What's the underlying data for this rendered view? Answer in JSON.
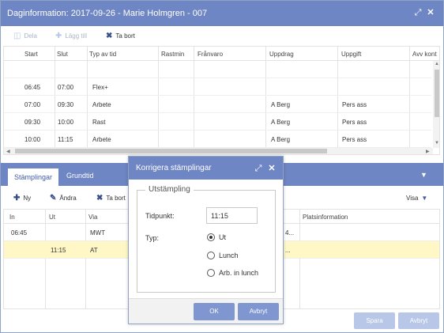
{
  "window": {
    "title": "Daginformation: 2017-09-26 - Marie Holmgren - 007"
  },
  "toolbar": {
    "dela": "Dela",
    "lagg_till": "Lägg till",
    "ta_bort": "Ta bort"
  },
  "grid": {
    "headers": [
      "Start",
      "Slut",
      "Typ av tid",
      "Rastmin",
      "Frånvaro",
      "Uppdrag",
      "Uppgift",
      "Avv kont"
    ],
    "rows": [
      [
        "",
        "",
        "",
        "",
        "",
        "",
        "",
        ""
      ],
      [
        "06:45",
        "07:00",
        "Flex+",
        "",
        "",
        "",
        "",
        ""
      ],
      [
        "07:00",
        "09:30",
        "Arbete",
        "",
        "",
        "A Berg",
        "Pers ass",
        ""
      ],
      [
        "09:30",
        "10:00",
        "Rast",
        "",
        "",
        "A Berg",
        "Pers ass",
        ""
      ],
      [
        "10:00",
        "11:15",
        "Arbete",
        "",
        "",
        "A Berg",
        "Pers ass",
        ""
      ]
    ]
  },
  "tabs": {
    "stamplingar": "Stämplingar",
    "grundtid": "Grundtid"
  },
  "toolbar2": {
    "ny": "Ny",
    "andra": "Ändra",
    "ta_bort": "Ta bort",
    "visa": "Visa"
  },
  "grid2": {
    "headers": [
      "In",
      "Ut",
      "Via",
      "Platsinformation"
    ],
    "rows": [
      [
        "06:45",
        "",
        "MWT",
        "4..."
      ],
      [
        "",
        "11:15",
        "AT",
        "..."
      ]
    ]
  },
  "footer": {
    "spara": "Spara",
    "avbryt": "Avbryt"
  },
  "modal": {
    "title": "Korrigera stämplingar",
    "fieldset_legend": "Utstämpling",
    "tidpunkt_label": "Tidpunkt:",
    "tidpunkt_value": "11:15",
    "typ_label": "Typ:",
    "options": [
      "Ut",
      "Lunch",
      "Arb. in lunch"
    ],
    "selected_option": "Ut",
    "ok": "OK",
    "avbryt": "Avbryt"
  },
  "colors": {
    "titlebar": "#6f86c4",
    "selected_row": "#fff8c6",
    "button": "#7f96d0"
  }
}
